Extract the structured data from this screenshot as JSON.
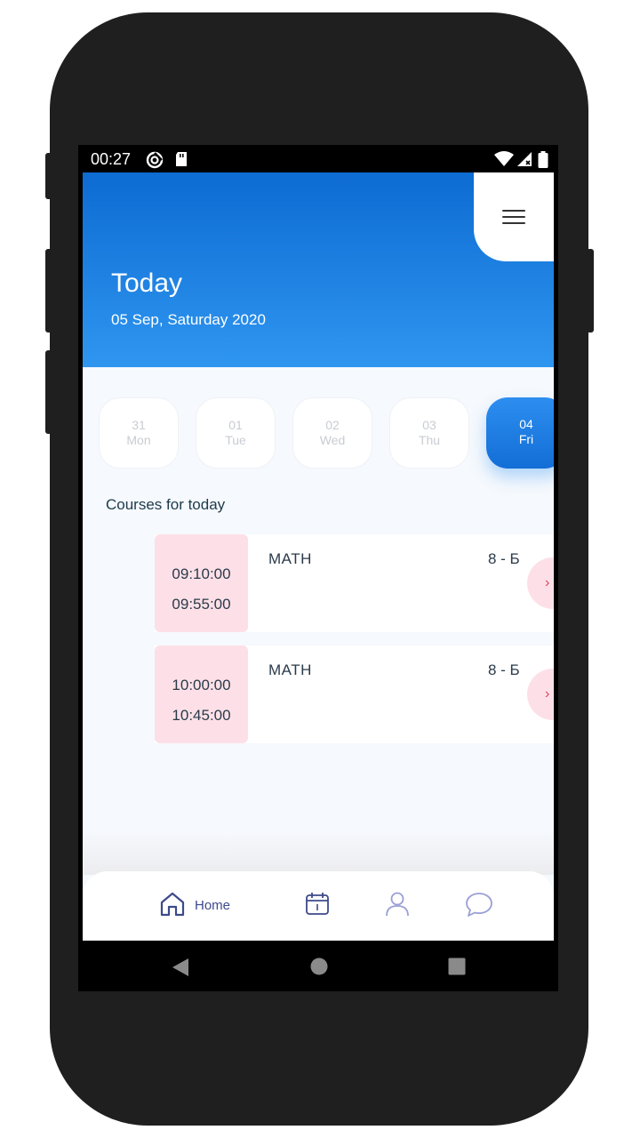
{
  "status_bar": {
    "time": "00:27"
  },
  "header": {
    "title": "Today",
    "date": "05 Sep, Saturday 2020"
  },
  "days": [
    {
      "num": "31",
      "name": "Mon",
      "active": false
    },
    {
      "num": "01",
      "name": "Tue",
      "active": false
    },
    {
      "num": "02",
      "name": "Wed",
      "active": false
    },
    {
      "num": "03",
      "name": "Thu",
      "active": false
    },
    {
      "num": "04",
      "name": "Fri",
      "active": true
    }
  ],
  "section_title": "Courses for today",
  "courses": [
    {
      "start": "09:10:00",
      "end": "09:55:00",
      "name": "MATH",
      "group": "8 - Б"
    },
    {
      "start": "10:00:00",
      "end": "10:45:00",
      "name": "MATH",
      "group": "8 - Б"
    }
  ],
  "bottom_nav": {
    "home_label": "Home"
  },
  "colors": {
    "header_top": "#0d6bd2",
    "header_bottom": "#2f96f0",
    "time_box": "#fde0e7",
    "nav_active": "#3d4a8a"
  },
  "icons": {
    "menu": "hamburger-icon",
    "home": "home-icon",
    "calendar": "calendar-icon",
    "profile": "user-icon",
    "chat": "chat-icon"
  }
}
